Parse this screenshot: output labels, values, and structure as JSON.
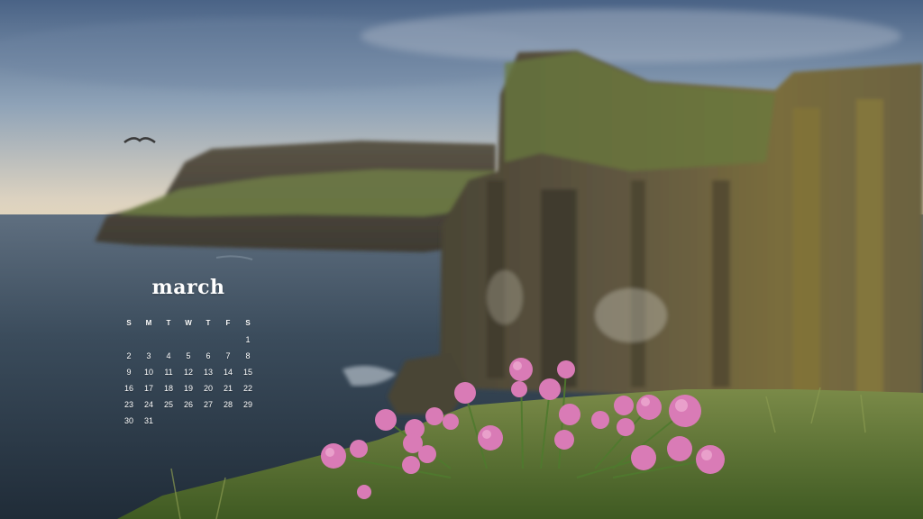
{
  "calendar": {
    "month": "march",
    "weekdays": [
      "S",
      "M",
      "T",
      "W",
      "T",
      "F",
      "S"
    ],
    "first_weekday_index": 6,
    "day_count": 31
  },
  "scene": {
    "subject": "sea cliffs with pink sea thrift flowers",
    "sky_color": "#8fa3b8",
    "sea_color": "#3b4c5c",
    "cliff_color": "#6b6240",
    "grass_color": "#5f7a38",
    "flower_color": "#d97bb6"
  }
}
